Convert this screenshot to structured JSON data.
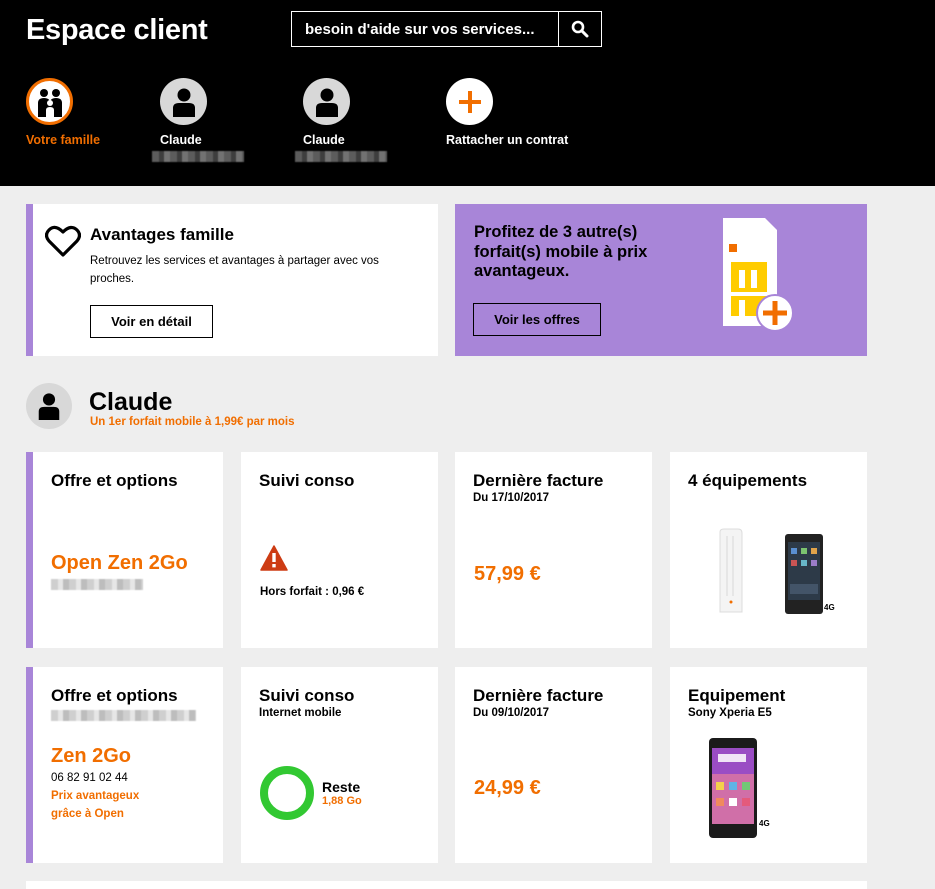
{
  "header": {
    "title": "Espace client",
    "search_placeholder": "besoin d'aide sur vos services...",
    "profiles": [
      {
        "label": "Votre famille",
        "icon": "family-icon",
        "active": true
      },
      {
        "label": "Claude",
        "icon": "user-icon",
        "active": false
      },
      {
        "label": "Claude",
        "icon": "user-icon",
        "active": false
      },
      {
        "label": "Rattacher un contrat",
        "icon": "plus-icon",
        "active": false
      }
    ]
  },
  "family_card": {
    "title": "Avantages famille",
    "description": "Retrouvez les services et avantages à partager avec vos proches.",
    "button": "Voir en détail"
  },
  "promo_card": {
    "text": "Profitez de 3 autre(s) forfait(s) mobile à prix avantageux.",
    "button": "Voir les offres"
  },
  "user": {
    "name": "Claude",
    "subtitle": "Un 1er forfait mobile à 1,99€ par mois"
  },
  "row1": {
    "offer": {
      "title": "Offre et options",
      "plan": "Open Zen 2Go"
    },
    "conso": {
      "title": "Suivi conso",
      "text": "Hors forfait : 0,96 €"
    },
    "bill": {
      "title": "Dernière facture",
      "date": "Du 17/10/2017",
      "amount": "57,99 €"
    },
    "equipment": {
      "title": "4 équipements",
      "badge": "4G"
    }
  },
  "row2": {
    "offer": {
      "title": "Offre et options",
      "plan": "Zen 2Go",
      "phone": "06 82 91 02 44",
      "note_line1": "Prix avantageux",
      "note_line2": "grâce à Open"
    },
    "conso": {
      "title": "Suivi conso",
      "subtitle": "Internet mobile",
      "remaining_label": "Reste",
      "remaining_value": "1,88 Go"
    },
    "bill": {
      "title": "Dernière facture",
      "date": "Du 09/10/2017",
      "amount": "24,99 €"
    },
    "equipment": {
      "title": "Equipement",
      "model": "Sony Xperia E5",
      "badge": "4G"
    }
  },
  "colors": {
    "accent": "#f16e00",
    "purple": "#a885d8",
    "header_bg": "#000000",
    "page_bg": "#eeeeee",
    "success": "#32c832",
    "danger": "#cd3c14"
  }
}
